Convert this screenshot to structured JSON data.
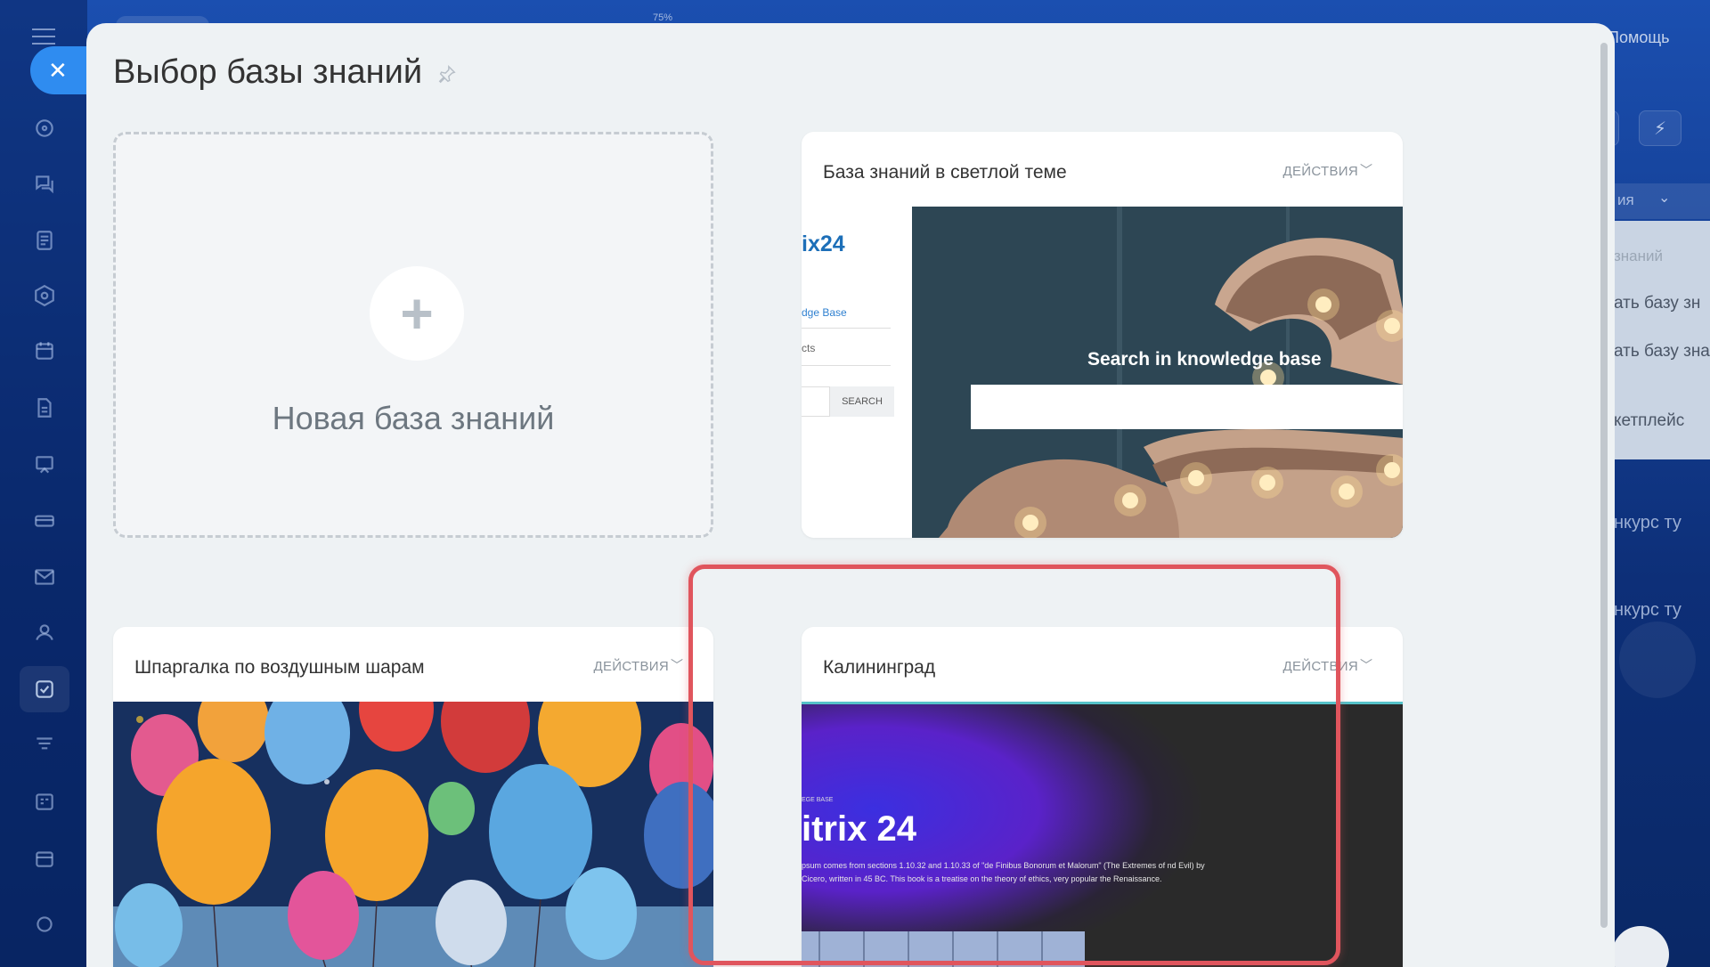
{
  "background": {
    "zoom": "75%",
    "help": "Помощь",
    "right_panel": {
      "field_text": "ия",
      "items": [
        "знаний",
        "ать базу зн",
        "ать базу зна",
        "кетплейс"
      ],
      "list_items": [
        "нкурс ту",
        "нкурс ту"
      ]
    }
  },
  "panel": {
    "title": "Выбор базы знаний",
    "new_card": {
      "plus": "+",
      "label": "Новая база знаний"
    },
    "cards": [
      {
        "title": "База знаний в светлой теме",
        "actions": "ДЕЙСТВИЯ",
        "preview": {
          "logo": "ix24",
          "link": "dge Base",
          "menu_item": "cts",
          "search_button": "SEARCH",
          "hero_text": "Search in knowledge base"
        }
      },
      {
        "title": "Шпаргалка по воздушным шарам",
        "actions": "ДЕЙСТВИЯ",
        "preview": {}
      },
      {
        "title": "Калининград",
        "actions": "ДЕЙСТВИЯ",
        "preview": {
          "eyebrow": "EGE BASE",
          "headline": "itrix 24",
          "body": "psum comes from sections 1.10.32 and 1.10.33 of \"de Finibus Bonorum et Malorum\" (The Extremes of nd Evil) by Cicero, written in 45 BC. This book is a treatise on the theory of ethics, very popular the Renaissance."
        }
      }
    ]
  },
  "colors": {
    "accent": "#2f8cf0",
    "highlight": "#e0555d",
    "panel_bg": "#eef2f4"
  }
}
